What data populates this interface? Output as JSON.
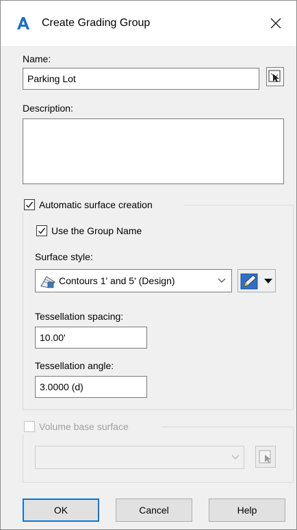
{
  "window": {
    "title": "Create Grading Group",
    "app_icon": "autocad-a-icon",
    "close_icon": "close-icon"
  },
  "name": {
    "label": "Name:",
    "value": "Parking Lot",
    "pick_button_icon": "pick-from-drawing-icon"
  },
  "description": {
    "label": "Description:",
    "value": ""
  },
  "auto_surface": {
    "label": "Automatic surface creation",
    "checked": true,
    "use_group_name": {
      "label": "Use the Group Name",
      "checked": true
    },
    "surface_style": {
      "label": "Surface style:",
      "selected": "Contours 1' and 5' (Design)",
      "style_icon": "surface-style-icon",
      "edit_icon": "edit-style-icon",
      "dropdown_icon": "chevron-down-icon"
    },
    "tessellation_spacing": {
      "label": "Tessellation spacing:",
      "value": "10.00'"
    },
    "tessellation_angle": {
      "label": "Tessellation angle:",
      "value": "3.0000 (d)"
    }
  },
  "volume_base": {
    "label": "Volume base surface",
    "checked": false,
    "enabled": false,
    "selected": ""
  },
  "buttons": {
    "ok": "OK",
    "cancel": "Cancel",
    "help": "Help"
  },
  "colors": {
    "accent": "#0078d7",
    "dialog_bg": "#f0f0f0",
    "autocad_red": "#1e6fc8"
  }
}
